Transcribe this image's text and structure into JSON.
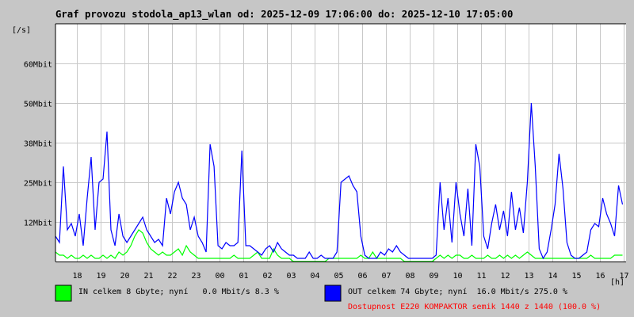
{
  "chart_data": {
    "type": "line",
    "title": "Graf provozu stodola_ap13_wlan od: 2025-12-09 17:06:00 do: 2025-12-10 17:05:00",
    "ylabel": "[/s]",
    "xlabel": "[h]",
    "ylim": [
      0,
      75
    ],
    "grid": true,
    "y_ticks": [
      {
        "value": 12.5,
        "label": "12Mbit"
      },
      {
        "value": 25,
        "label": "25Mbit"
      },
      {
        "value": 37.5,
        "label": "38Mbit"
      },
      {
        "value": 50,
        "label": "50Mbit"
      },
      {
        "value": 62.5,
        "label": "60Mbit"
      }
    ],
    "x_range_minutes": [
      0,
      1439
    ],
    "x_ticks": [
      {
        "minute": 54,
        "label": "18"
      },
      {
        "minute": 114,
        "label": "19"
      },
      {
        "minute": 174,
        "label": "20"
      },
      {
        "minute": 234,
        "label": "21"
      },
      {
        "minute": 294,
        "label": "22"
      },
      {
        "minute": 354,
        "label": "23"
      },
      {
        "minute": 414,
        "label": "00"
      },
      {
        "minute": 474,
        "label": "01"
      },
      {
        "minute": 534,
        "label": "02"
      },
      {
        "minute": 594,
        "label": "03"
      },
      {
        "minute": 654,
        "label": "04"
      },
      {
        "minute": 714,
        "label": "05"
      },
      {
        "minute": 774,
        "label": "06"
      },
      {
        "minute": 834,
        "label": "07"
      },
      {
        "minute": 894,
        "label": "08"
      },
      {
        "minute": 954,
        "label": "09"
      },
      {
        "minute": 1014,
        "label": "10"
      },
      {
        "minute": 1074,
        "label": "11"
      },
      {
        "minute": 1134,
        "label": "12"
      },
      {
        "minute": 1194,
        "label": "13"
      },
      {
        "minute": 1254,
        "label": "14"
      },
      {
        "minute": 1314,
        "label": "15"
      },
      {
        "minute": 1374,
        "label": "16"
      },
      {
        "minute": 1434,
        "label": "17"
      }
    ],
    "sample_interval_minutes": 10,
    "series": [
      {
        "name": "IN",
        "color": "#00ff00",
        "unit": "Mbit/s",
        "values": [
          3,
          2,
          2,
          1,
          2,
          1,
          1,
          2,
          1,
          2,
          1,
          1,
          2,
          1,
          2,
          1,
          3,
          2,
          3,
          5,
          8,
          10,
          9,
          6,
          4,
          3,
          2,
          3,
          2,
          2,
          3,
          4,
          2,
          5,
          3,
          2,
          1,
          1,
          1,
          1,
          1,
          1,
          1,
          1,
          1,
          2,
          1,
          1,
          1,
          1,
          2,
          3,
          1,
          1,
          1,
          4,
          2,
          1,
          1,
          1,
          0,
          0,
          0,
          0,
          0,
          0,
          0,
          0,
          0,
          1,
          1,
          1,
          1,
          1,
          1,
          1,
          1,
          2,
          1,
          1,
          3,
          1,
          1,
          1,
          1,
          1,
          1,
          1,
          0,
          0,
          0,
          0,
          0,
          0,
          0,
          0,
          1,
          2,
          1,
          2,
          1,
          2,
          2,
          1,
          1,
          2,
          1,
          1,
          1,
          2,
          1,
          1,
          2,
          1,
          2,
          1,
          2,
          1,
          2,
          3,
          2,
          1,
          1,
          1,
          1,
          1,
          1,
          1,
          1,
          1,
          1,
          1,
          1,
          1,
          1,
          2,
          1,
          1,
          1,
          1,
          1,
          2,
          2,
          2
        ]
      },
      {
        "name": "OUT",
        "color": "#0000ff",
        "unit": "Mbit/s",
        "values": [
          8,
          6,
          30,
          10,
          12,
          8,
          15,
          5,
          20,
          33,
          10,
          25,
          26,
          41,
          10,
          5,
          15,
          8,
          6,
          8,
          10,
          12,
          14,
          10,
          8,
          6,
          7,
          5,
          20,
          15,
          22,
          25,
          20,
          18,
          10,
          14,
          8,
          6,
          3,
          37,
          30,
          5,
          4,
          6,
          5,
          5,
          6,
          35,
          5,
          5,
          4,
          3,
          2,
          4,
          5,
          3,
          6,
          4,
          3,
          2,
          2,
          1,
          1,
          1,
          3,
          1,
          1,
          2,
          1,
          1,
          1,
          3,
          25,
          26,
          27,
          24,
          22,
          8,
          2,
          1,
          1,
          1,
          3,
          2,
          4,
          3,
          5,
          3,
          2,
          1,
          1,
          1,
          1,
          1,
          1,
          1,
          2,
          25,
          10,
          20,
          6,
          25,
          15,
          8,
          23,
          5,
          37,
          30,
          8,
          4,
          12,
          18,
          10,
          16,
          8,
          22,
          10,
          17,
          9,
          25,
          50,
          30,
          4,
          1,
          3,
          10,
          18,
          34,
          23,
          6,
          2,
          1,
          1,
          2,
          3,
          10,
          12,
          11,
          20,
          15,
          12,
          8,
          24,
          18
        ]
      }
    ]
  },
  "legend": {
    "in_text": "IN celkem 8 Gbyte; nyní   0.0 Mbit/s 8.3 %",
    "out_text": "OUT celkem 74 Gbyte; nyní  16.0 Mbit/s 275.0 %",
    "availability": "Dostupnost E220 KOMPAKTOR semik 1440 z 1440 (100.0 %)",
    "availability_color": "#ff0000"
  }
}
